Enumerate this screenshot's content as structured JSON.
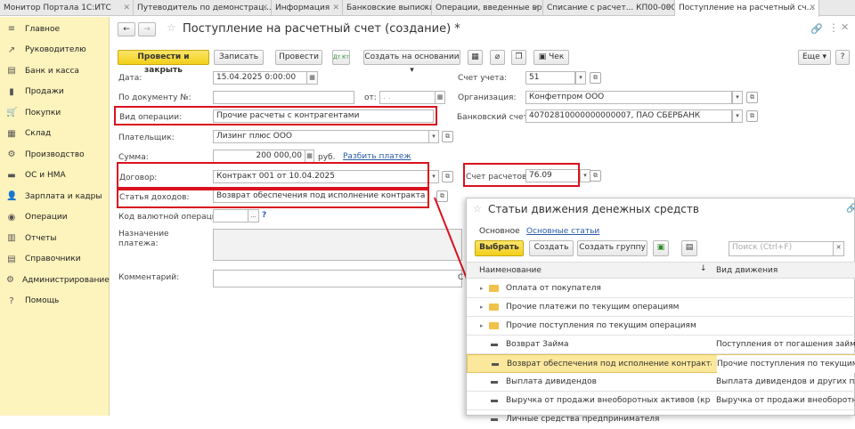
{
  "tabs": [
    {
      "label": "Монитор Портала 1С:ИТС",
      "active": false
    },
    {
      "label": "Путеводитель по демонстрац...",
      "active": false
    },
    {
      "label": "Информация",
      "active": false
    },
    {
      "label": "Банковские выписки",
      "active": false
    },
    {
      "label": "Операции, введенные вручную",
      "active": false
    },
    {
      "label": "Списание с расчет... КП00-00001С",
      "active": false
    },
    {
      "label": "Поступление на расчетный сч...",
      "active": true
    }
  ],
  "sidebar": {
    "items": [
      {
        "label": "Главное",
        "icon": "≡"
      },
      {
        "label": "Руководителю",
        "icon": "↗"
      },
      {
        "label": "Банк и касса",
        "icon": "▤"
      },
      {
        "label": "Продажи",
        "icon": "▮"
      },
      {
        "label": "Покупки",
        "icon": "🛒"
      },
      {
        "label": "Склад",
        "icon": "▦"
      },
      {
        "label": "Производство",
        "icon": "⚙"
      },
      {
        "label": "ОС и НМА",
        "icon": "▬"
      },
      {
        "label": "Зарплата и кадры",
        "icon": "👤"
      },
      {
        "label": "Операции",
        "icon": "◉"
      },
      {
        "label": "Отчеты",
        "icon": "▥"
      },
      {
        "label": "Справочники",
        "icon": "▤"
      },
      {
        "label": "Администрирование",
        "icon": "⚙"
      },
      {
        "label": "Помощь",
        "icon": "?"
      }
    ]
  },
  "doc": {
    "title": "Поступление на расчетный счет (создание) *",
    "toolbar": {
      "post_close": "Провести и закрыть",
      "save": "Записать",
      "post": "Провести",
      "dt_kt": "Дт Кт",
      "create_basis": "Создать на основании",
      "check": "Чек",
      "more": "Еще"
    },
    "labels": {
      "date": "Дата:",
      "by_doc": "По документу №:",
      "from": "от:",
      "op_type": "Вид операции:",
      "payer": "Плательщик:",
      "sum": "Сумма:",
      "contract": "Договор:",
      "income_item": "Статья доходов:",
      "currency_op_code": "Код валютной операции:",
      "purpose": "Назначение платежа:",
      "comment": "Комментарий:",
      "account": "Счет учета:",
      "org": "Организация:",
      "bank_account": "Банковский счет:",
      "settlement_account": "Счет расчетов:",
      "rub": "руб.",
      "split": "Разбить платеж"
    },
    "values": {
      "date": "15.04.2025  0:00:00",
      "by_doc": "",
      "from": ". .",
      "op_type": "Прочие расчеты с контрагентами",
      "payer": "Лизинг плюс ООО",
      "sum": "200 000,00",
      "contract": "Контракт 001 от 10.04.2025",
      "income_item": "Возврат обеспечения под исполнение контракта",
      "account": "51",
      "org": "Конфетпром ООО",
      "bank_account": "40702810000000000007, ПАО СБЕРБАНК",
      "settlement_account": "76.09"
    }
  },
  "popup": {
    "title": "Статьи движения денежных средств",
    "tabs": [
      "Основное",
      "Основные статьи"
    ],
    "toolbar": {
      "select": "Выбрать",
      "create": "Создать",
      "create_group": "Создать группу"
    },
    "search_placeholder": "Поиск (Ctrl+F)",
    "columns": [
      "Наименование",
      "Вид движения"
    ],
    "rows": [
      {
        "name": "Оплата от покупателя",
        "kind": "",
        "type": "folder"
      },
      {
        "name": "Прочие платежи по текущим операциям",
        "kind": "",
        "type": "folder"
      },
      {
        "name": "Прочие поступления по текущим операциям",
        "kind": "",
        "type": "folder"
      },
      {
        "name": "Возврат Займа",
        "kind": "Поступления от погашения займов, от...",
        "type": "leaf"
      },
      {
        "name": "Возврат обеспечения под исполнение контракта",
        "kind": "Прочие поступления по текущим операц...",
        "type": "leaf",
        "selected": true
      },
      {
        "name": "Выплата дивидендов",
        "kind": "Выплата дивидендов и других платеже...",
        "type": "leaf"
      },
      {
        "name": "Выручка от продажи внеоборотных активов (кроме ф...",
        "kind": "Выручка от продажи внеоборотных акти...",
        "type": "leaf"
      },
      {
        "name": "Личные средства предпринимателя",
        "kind": "",
        "type": "leaf"
      }
    ]
  },
  "colors": {
    "accent_yellow": "#f2cf1a",
    "sidebar_bg": "#fdf3bd",
    "highlight_red": "#d8121f",
    "selected_row": "#fbe89c"
  }
}
